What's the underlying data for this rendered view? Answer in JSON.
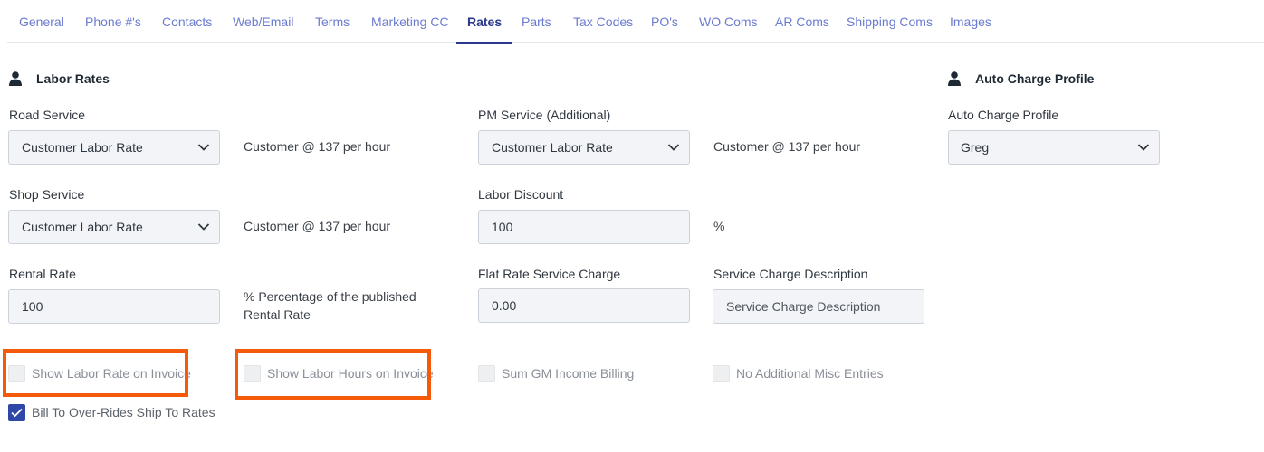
{
  "tabs": [
    {
      "label": "General"
    },
    {
      "label": "Phone #'s"
    },
    {
      "label": "Contacts"
    },
    {
      "label": "Web/Email"
    },
    {
      "label": "Terms"
    },
    {
      "label": "Marketing CC"
    },
    {
      "label": "Rates",
      "active": true
    },
    {
      "label": "Parts"
    },
    {
      "label": "Tax Codes"
    },
    {
      "label": "PO's"
    },
    {
      "label": "WO Coms"
    },
    {
      "label": "AR Coms"
    },
    {
      "label": "Shipping Coms"
    },
    {
      "label": "Images"
    }
  ],
  "labor_rates": {
    "title": "Labor Rates",
    "road_service": {
      "label": "Road Service",
      "value": "Customer Labor Rate",
      "note": "Customer @ 137 per hour"
    },
    "shop_service": {
      "label": "Shop Service",
      "value": "Customer Labor Rate",
      "note": "Customer @ 137 per hour"
    },
    "rental_rate": {
      "label": "Rental Rate",
      "value": "100",
      "note": "% Percentage of the published Rental Rate"
    },
    "pm_service": {
      "label": "PM Service (Additional)",
      "value": "Customer Labor Rate",
      "note": "Customer @ 137 per hour"
    },
    "labor_discount": {
      "label": "Labor Discount",
      "value": "100",
      "note": "%"
    },
    "flat_rate": {
      "label": "Flat Rate Service Charge",
      "value": "0.00"
    },
    "service_charge_desc": {
      "label": "Service Charge Description",
      "placeholder": "Service Charge Description"
    }
  },
  "auto_charge": {
    "title": "Auto Charge Profile",
    "label": "Auto Charge Profile",
    "value": "Greg"
  },
  "checkboxes": {
    "show_labor_rate": {
      "label": "Show Labor Rate on Invoice",
      "checked": false
    },
    "show_labor_hours": {
      "label": "Show Labor Hours on Invoice",
      "checked": false
    },
    "sum_gm_income": {
      "label": "Sum GM Income Billing",
      "checked": false
    },
    "no_misc_entries": {
      "label": "No Additional Misc Entries",
      "checked": false
    },
    "bill_to_overrides": {
      "label": "Bill To Over-Rides Ship To Rates",
      "checked": true
    }
  },
  "colors": {
    "tab_text": "#6b7bd0",
    "tab_active": "#2c3a8c",
    "highlight": "#f55a0a",
    "checkbox_checked": "#2f48a8"
  }
}
